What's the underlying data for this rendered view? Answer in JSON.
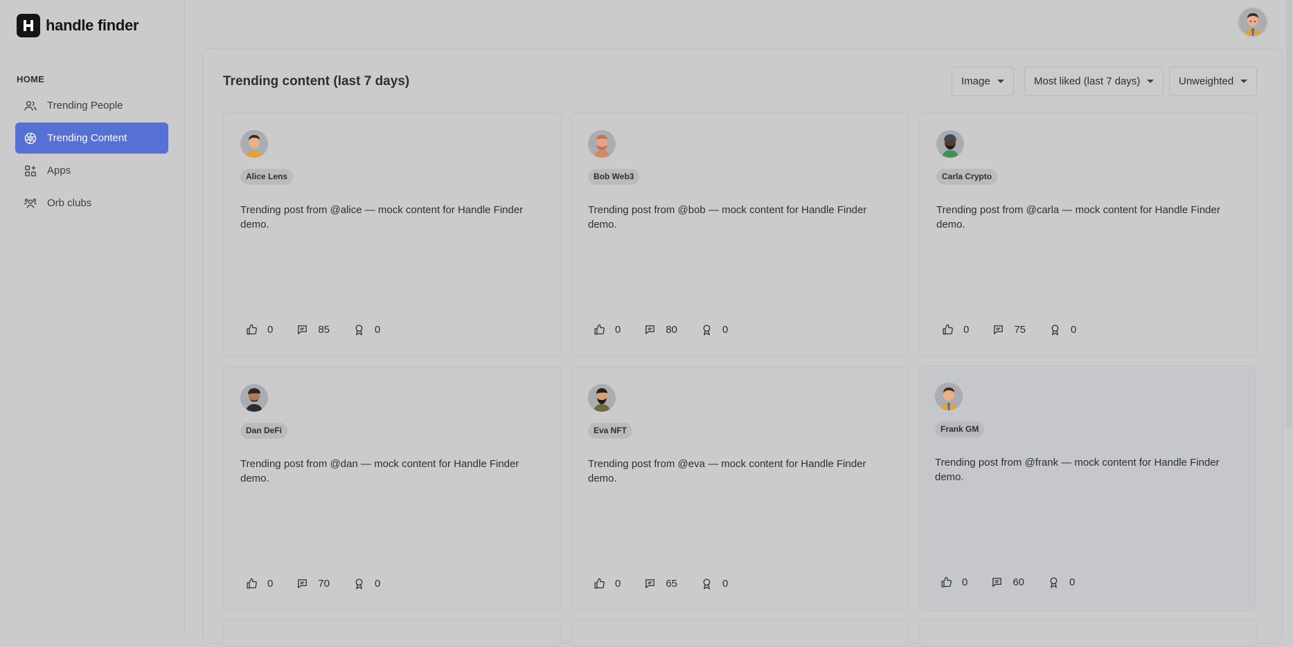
{
  "brand": {
    "name": "handle finder"
  },
  "sidebar": {
    "section_label": "HOME",
    "items": [
      {
        "label": "Trending People",
        "icon": "users-icon",
        "active": false
      },
      {
        "label": "Trending Content",
        "icon": "aperture-icon",
        "active": true
      },
      {
        "label": "Apps",
        "icon": "apps-grid-icon",
        "active": false
      },
      {
        "label": "Orb clubs",
        "icon": "group-icon",
        "active": false
      }
    ]
  },
  "main": {
    "title": "Trending content (last 7 days)",
    "filters": {
      "type": "Image",
      "sort": "Most liked (last 7 days)",
      "weighting": "Unweighted"
    },
    "cards": [
      {
        "name": "Alice Lens",
        "text": "Trending post from @alice — mock content for Handle Finder demo.",
        "likes": "0",
        "comments": "85",
        "collects": "0"
      },
      {
        "name": "Bob Web3",
        "text": "Trending post from @bob — mock content for Handle Finder demo.",
        "likes": "0",
        "comments": "80",
        "collects": "0"
      },
      {
        "name": "Carla Crypto",
        "text": "Trending post from @carla — mock content for Handle Finder demo.",
        "likes": "0",
        "comments": "75",
        "collects": "0"
      },
      {
        "name": "Dan DeFi",
        "text": "Trending post from @dan — mock content for Handle Finder demo.",
        "likes": "0",
        "comments": "70",
        "collects": "0"
      },
      {
        "name": "Eva NFT",
        "text": "Trending post from @eva — mock content for Handle Finder demo.",
        "likes": "0",
        "comments": "65",
        "collects": "0"
      },
      {
        "name": "Frank GM",
        "text": "Trending post from @frank — mock content for Handle Finder demo.",
        "likes": "0",
        "comments": "60",
        "collects": "0"
      }
    ]
  },
  "colors": {
    "accent": "#5670d6",
    "background": "#cbcbcb",
    "chip": "#bbbbbb"
  }
}
